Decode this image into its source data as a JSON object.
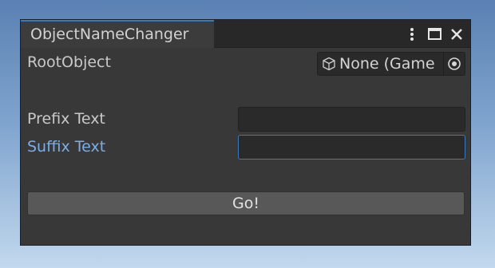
{
  "window": {
    "tab_title": "ObjectNameChanger"
  },
  "icons": {
    "menu": "vertical-dots-icon",
    "maximize": "maximize-icon",
    "close": "close-icon",
    "object": "cube-icon",
    "picker": "object-picker-icon"
  },
  "fields": {
    "root_object": {
      "label": "RootObject",
      "value": "None (Game"
    },
    "prefix": {
      "label": "Prefix Text",
      "value": ""
    },
    "suffix": {
      "label": "Suffix Text",
      "value": ""
    }
  },
  "actions": {
    "go_label": "Go!"
  },
  "colors": {
    "accent": "#3a79bb",
    "focused_label": "#7aaee8",
    "panel_bg": "#383838"
  }
}
